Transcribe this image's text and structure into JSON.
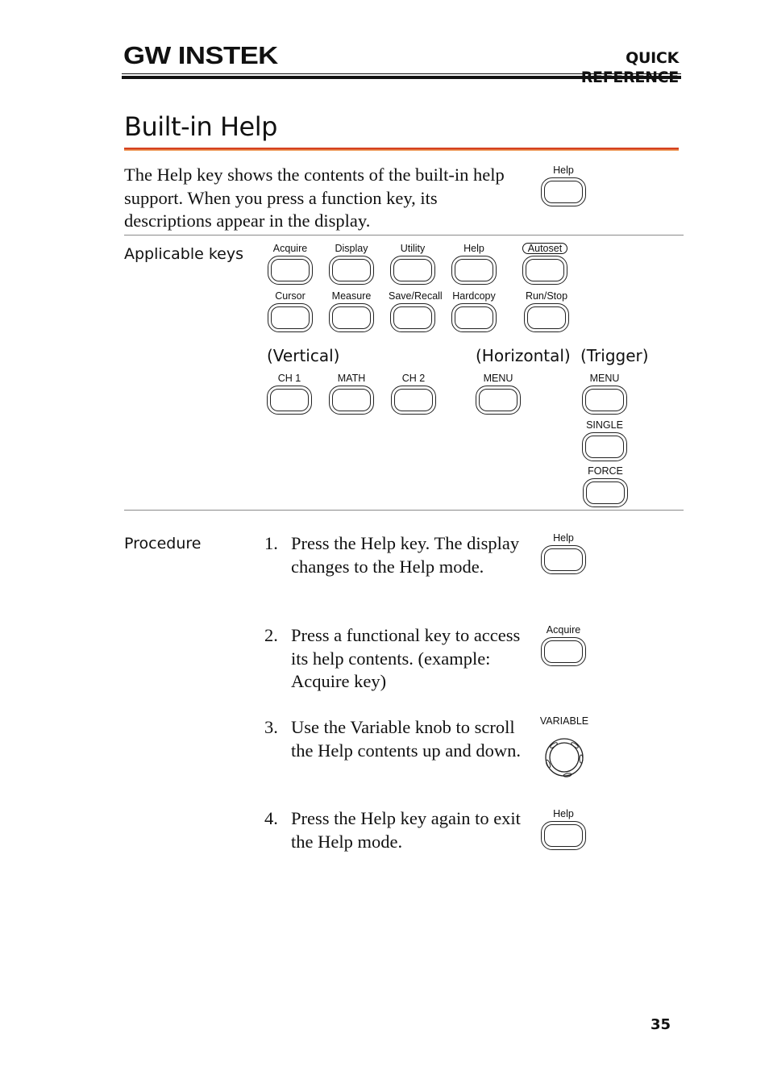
{
  "header": {
    "brand": "GW INSTEK",
    "section": "QUICK REFERENCE"
  },
  "page": {
    "title": "Built-in Help",
    "number": "35"
  },
  "intro": {
    "text": "The Help key shows the contents of the built-in help support. When you press a function key, its descriptions appear in the display.",
    "key_label": "Help"
  },
  "applicable": {
    "label": "Applicable keys",
    "row1": [
      "Acquire",
      "Display",
      "Utility",
      "Help",
      "Autoset"
    ],
    "row2": [
      "Cursor",
      "Measure",
      "Save/Recall",
      "Hardcopy",
      "Run/Stop"
    ],
    "groups": {
      "vertical": "(Vertical)",
      "horizontal": "(Horizontal)",
      "trigger": "(Trigger)"
    },
    "vertical_keys": [
      "CH 1",
      "MATH",
      "CH 2"
    ],
    "horizontal_keys": [
      "MENU"
    ],
    "trigger_keys": [
      "MENU",
      "SINGLE",
      "FORCE"
    ]
  },
  "procedure": {
    "label": "Procedure",
    "steps": [
      {
        "num": "1.",
        "text": "Press the Help key. The display changes to the Help mode.",
        "key": "Help"
      },
      {
        "num": "2.",
        "text": "Press a functional key to access its help contents. (example: Acquire key)",
        "key": "Acquire"
      },
      {
        "num": "3.",
        "text": "Use the Variable knob to scroll the Help contents up and down.",
        "key": "VARIABLE"
      },
      {
        "num": "4.",
        "text": "Press the Help key again to exit the Help mode.",
        "key": "Help"
      }
    ]
  }
}
